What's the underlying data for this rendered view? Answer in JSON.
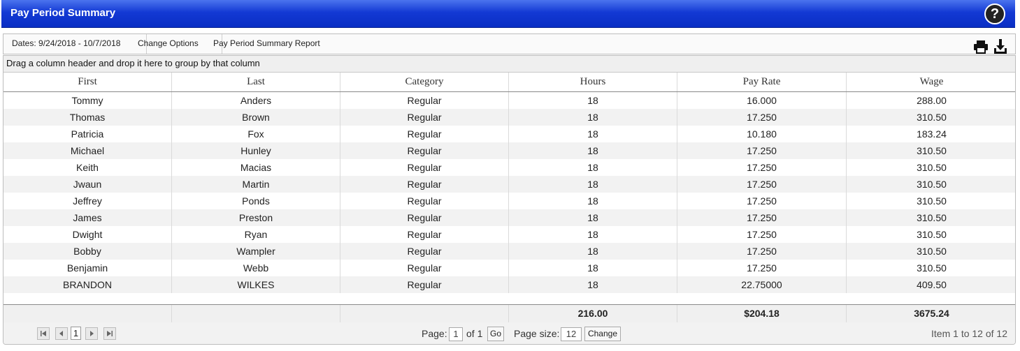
{
  "header": {
    "title": "Pay Period Summary",
    "help_icon": "help-icon"
  },
  "toolbar": {
    "dates": "Dates: 9/24/2018 - 10/7/2018",
    "change_options": "Change Options",
    "report": "Pay Period Summary Report",
    "icons": [
      "print-icon",
      "download-icon"
    ]
  },
  "grid": {
    "group_hint": "Drag a column header and drop it here to group by that column",
    "columns": [
      "First",
      "Last",
      "Category",
      "Hours",
      "Pay Rate",
      "Wage"
    ],
    "rows": [
      [
        "Tommy",
        "Anders",
        "Regular",
        "18",
        "16.000",
        "288.00"
      ],
      [
        "Thomas",
        "Brown",
        "Regular",
        "18",
        "17.250",
        "310.50"
      ],
      [
        "Patricia",
        "Fox",
        "Regular",
        "18",
        "10.180",
        "183.24"
      ],
      [
        "Michael",
        "Hunley",
        "Regular",
        "18",
        "17.250",
        "310.50"
      ],
      [
        "Keith",
        "Macias",
        "Regular",
        "18",
        "17.250",
        "310.50"
      ],
      [
        "Jwaun",
        "Martin",
        "Regular",
        "18",
        "17.250",
        "310.50"
      ],
      [
        "Jeffrey",
        "Ponds",
        "Regular",
        "18",
        "17.250",
        "310.50"
      ],
      [
        "James",
        "Preston",
        "Regular",
        "18",
        "17.250",
        "310.50"
      ],
      [
        "Dwight",
        "Ryan",
        "Regular",
        "18",
        "17.250",
        "310.50"
      ],
      [
        "Bobby",
        "Wampler",
        "Regular",
        "18",
        "17.250",
        "310.50"
      ],
      [
        "Benjamin",
        "Webb",
        "Regular",
        "18",
        "17.250",
        "310.50"
      ],
      [
        "BRANDON",
        "WILKES",
        "Regular",
        "18",
        "22.75000",
        "409.50"
      ]
    ],
    "totals": [
      "",
      "",
      "",
      "216.00",
      "$204.18",
      "3675.24"
    ]
  },
  "pager": {
    "current_page": "1",
    "page_label": "Page:",
    "page_value": "1",
    "of_label": "of 1",
    "go_label": "Go",
    "page_size_label": "Page size:",
    "page_size_value": "12",
    "change_label": "Change",
    "item_info": "Item 1 to 12 of 12"
  }
}
